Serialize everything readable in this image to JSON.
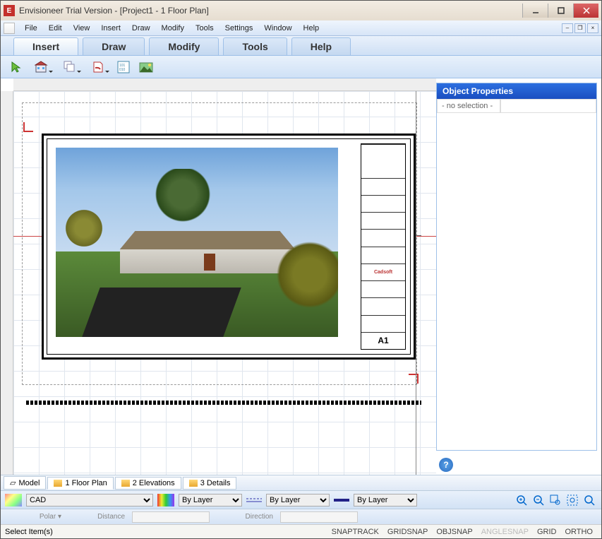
{
  "title": "Envisioneer Trial Version - [Project1 - 1 Floor Plan]",
  "menu": [
    "File",
    "Edit",
    "View",
    "Insert",
    "Draw",
    "Modify",
    "Tools",
    "Settings",
    "Window",
    "Help"
  ],
  "ribbonTabs": [
    "Insert",
    "Draw",
    "Modify",
    "Tools",
    "Help"
  ],
  "activeRibbon": "Insert",
  "properties": {
    "header": "Object Properties",
    "noSelection": "- no selection -"
  },
  "bottomTabs": [
    {
      "icon": "model",
      "label": "Model"
    },
    {
      "icon": "folder",
      "label": "1 Floor Plan"
    },
    {
      "icon": "folder",
      "label": "2 Elevations"
    },
    {
      "icon": "folder",
      "label": "3 Details"
    }
  ],
  "activeBottom": 1,
  "propBar": {
    "layer": "CAD",
    "colorSel": "By Layer",
    "ltypeSel": "By Layer",
    "lweightSel": "By Layer"
  },
  "propBar2": {
    "mode": "Polar",
    "distanceLabel": "Distance",
    "directionLabel": "Direction",
    "distance": "",
    "direction": ""
  },
  "status": {
    "left": "Select Item(s)",
    "snaps": [
      {
        "t": "SNAPTRACK",
        "on": true
      },
      {
        "t": "GRIDSNAP",
        "on": true
      },
      {
        "t": "OBJSNAP",
        "on": true
      },
      {
        "t": "ANGLESNAP",
        "on": false
      },
      {
        "t": "GRID",
        "on": true
      },
      {
        "t": "ORTHO",
        "on": true
      }
    ]
  },
  "titleblock": {
    "logo": "Cadsoft",
    "sheet": "A1"
  }
}
